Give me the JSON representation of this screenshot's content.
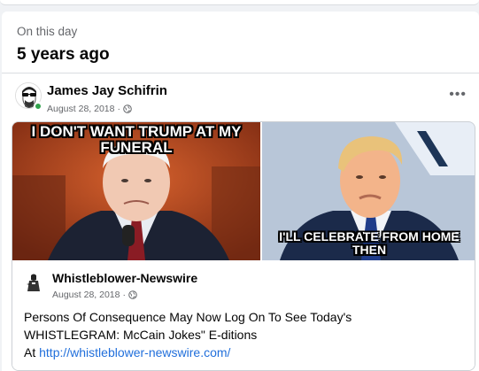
{
  "memories": {
    "label": "On this day",
    "title": "5 years ago"
  },
  "post": {
    "author": "James Jay Schifrin",
    "date": "August 28, 2018",
    "separator": "·",
    "more_label": "•••",
    "image_left": {
      "caption": "I DON'T WANT TRUMP AT MY FUNERAL"
    },
    "image_right": {
      "caption": "I'LL CELEBRATE FROM HOME THEN"
    }
  },
  "shared": {
    "page_name": "Whistleblower-Newswire",
    "date": "August 28, 2018",
    "separator": "·",
    "text_line1": "Persons Of Consequence May Now Log On To See Today's",
    "text_line2": "WHISTLEGRAM: McCain Jokes\" E-ditions",
    "text_prefix": "At ",
    "link": "http://whistleblower-newswire.com/"
  },
  "colors": {
    "link": "#216fdb",
    "meta": "#65676b",
    "online": "#31a24c"
  }
}
